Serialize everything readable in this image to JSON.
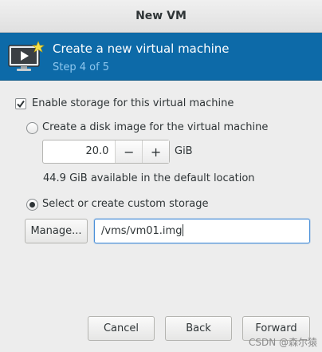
{
  "window": {
    "title": "New VM"
  },
  "banner": {
    "title": "Create a new virtual machine",
    "step": "Step 4 of 5",
    "icon": "monitor-play-icon"
  },
  "storage": {
    "enable_label": "Enable storage for this virtual machine",
    "enable_checked": true,
    "disk_image_label": "Create a disk image for the virtual machine",
    "disk_image_selected": false,
    "size_value": "20.0",
    "size_unit": "GiB",
    "available_text": "44.9 GiB available in the default location",
    "custom_label": "Select or create custom storage",
    "custom_selected": true,
    "manage_label": "Manage...",
    "path_value": "/vms/vm01.img"
  },
  "buttons": {
    "cancel": "Cancel",
    "back": "Back",
    "forward": "Forward"
  },
  "watermark": "CSDN @森尔猿"
}
